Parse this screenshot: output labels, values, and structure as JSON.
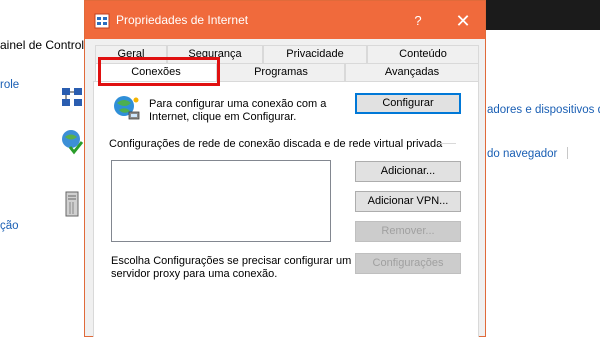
{
  "background_window": {
    "address": "ainel de Controle",
    "left_links": [
      "role",
      "ção"
    ],
    "right_links": [
      "adores e dispositivos de",
      "do navegador"
    ]
  },
  "dialog": {
    "title": "Propriedades de Internet",
    "help_symbol": "?",
    "close_symbol": "✕",
    "tabs_row1": [
      "Geral",
      "Segurança",
      "Privacidade",
      "Conteúdo"
    ],
    "tabs_row2": [
      "Conexões",
      "Programas",
      "Avançadas"
    ],
    "active_tab": "Conexões",
    "setup_text_line1": "Para configurar uma conexão com a",
    "setup_text_line2": "Internet, clique em Configurar.",
    "setup_button": "Configurar",
    "dialup_group_label": "Configurações de rede de conexão discada e de rede virtual privada",
    "add_button": "Adicionar...",
    "add_vpn_button": "Adicionar VPN...",
    "remove_button": "Remover...",
    "proxy_text_line1": "Escolha Configurações se precisar configurar um",
    "proxy_text_line2": "servidor proxy para uma conexão.",
    "settings_button": "Configurações"
  },
  "colors": {
    "titlebar": "#f06a3c",
    "highlight": "#e01010",
    "link": "#1a5fb4"
  }
}
